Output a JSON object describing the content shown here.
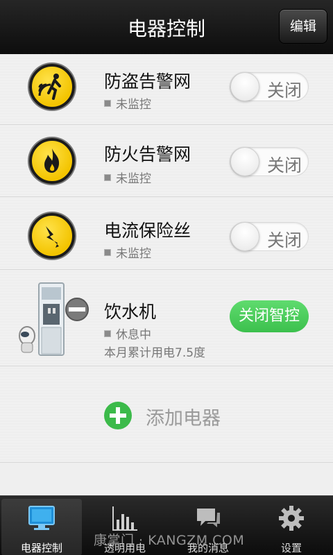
{
  "header": {
    "title": "电器控制",
    "edit_label": "编辑"
  },
  "devices": [
    {
      "name": "防盗告警网",
      "status": "未监控",
      "toggle_label": "关闭",
      "icon": "theft-alarm-icon"
    },
    {
      "name": "防火告警网",
      "status": "未监控",
      "toggle_label": "关闭",
      "icon": "fire-alarm-icon"
    },
    {
      "name": "电流保险丝",
      "status": "未监控",
      "toggle_label": "关闭",
      "icon": "lightning-icon"
    },
    {
      "name": "饮水机",
      "status": "休息中",
      "usage": "本月累计用电7.5度",
      "button_label": "关闭智控",
      "icon": "water-dispenser-icon"
    }
  ],
  "add": {
    "label": "添加电器"
  },
  "tabs": [
    {
      "label": "电器控制",
      "icon": "monitor-icon",
      "active": true
    },
    {
      "label": "透明用电",
      "icon": "bar-chart-icon",
      "active": false
    },
    {
      "label": "我的消息",
      "icon": "chat-bubble-icon",
      "active": false
    },
    {
      "label": "设置",
      "icon": "gear-icon",
      "active": false
    }
  ],
  "watermark": "康掌门 · KANGZM.COM",
  "colors": {
    "accent_green": "#3cc04d",
    "warning_yellow": "#f3c400",
    "header_bg": "#1a1a1a"
  }
}
